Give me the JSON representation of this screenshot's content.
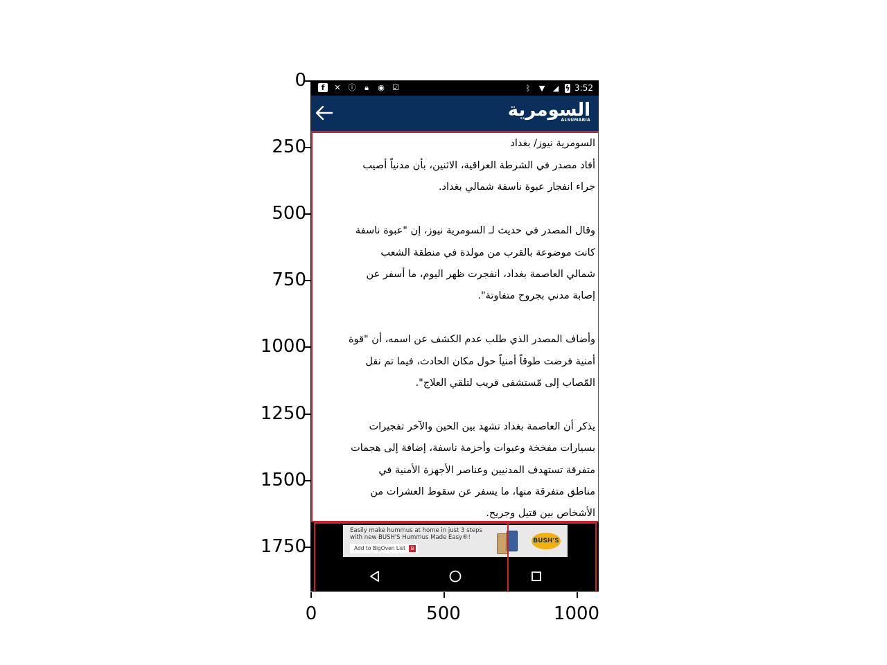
{
  "axes": {
    "y_ticks": [
      "0",
      "250",
      "500",
      "750",
      "1000",
      "1250",
      "1500",
      "1750"
    ],
    "x_ticks": [
      "0",
      "500",
      "1000"
    ]
  },
  "status_bar": {
    "time": "3:52",
    "left_icons": [
      "facebook-icon",
      "sync-off-icon",
      "info-icon",
      "lock-icon",
      "android-icon",
      "clipboard-check-icon"
    ],
    "right_icons": [
      "bluetooth-icon",
      "wifi-icon",
      "no-signal-icon",
      "battery-charging-icon"
    ]
  },
  "header": {
    "logo_arabic": "السومرية",
    "logo_english": "ALSUMARIA",
    "background": "#0b2f5c",
    "accent": "#d0202a"
  },
  "article": {
    "dateline": "السومرية نيوز/ بغداد",
    "lines": [
      "أفاد مصدر في الشرطة العراقية، الاثنين، بأن مدنياً أصيب",
      "جراء انفجار عبوة ناسفة شمالي بغداد.",
      "",
      "وقال المصدر في حديث لـ السومرية نيوز، إن \"عبوة ناسفة",
      "كانت موضوعة بالقرب من مولدة في منطقة الشعب",
      "شمالي العاصمة بغداد، انفجرت ظهر اليوم، ما أسفر عن",
      "إصابة مدني بجروح متفاوتة\".",
      "",
      "وأضاف المصدر الذي طلب عدم الكشف عن اسمه، أن \"قوة",
      "أمنية فرضت طوقاً أمنياً حول مكان الحادث، فيما تم نقل",
      "المّصاب إلى مّستشفى قريب لتلقي العلاج\".",
      "",
      "يذكر أن العاصمة بغداد تشهد بين الحين والآخر تفجيرات",
      "بسيارات مفخخة وعبوات وأحزمة ناسفة، إضافة إلى هجمات",
      "متفرقة تستهدف المدنيين وعناصر الأجهزة الأمنية في",
      "مناطق متفرقة منها، ما يسفر عن سقوط العشرات من",
      "الأشخاص بين قتيل وجريح."
    ]
  },
  "ad": {
    "line1": "Easily make hummus at home in just 3 steps",
    "line2": "with new BUSH'S Hummus Made Easy®!",
    "button_label": "Add to BigOven List",
    "brand": "BUSH'S"
  },
  "navbar": {
    "icons": [
      "back-triangle-icon",
      "home-circle-icon",
      "recents-square-icon"
    ]
  }
}
